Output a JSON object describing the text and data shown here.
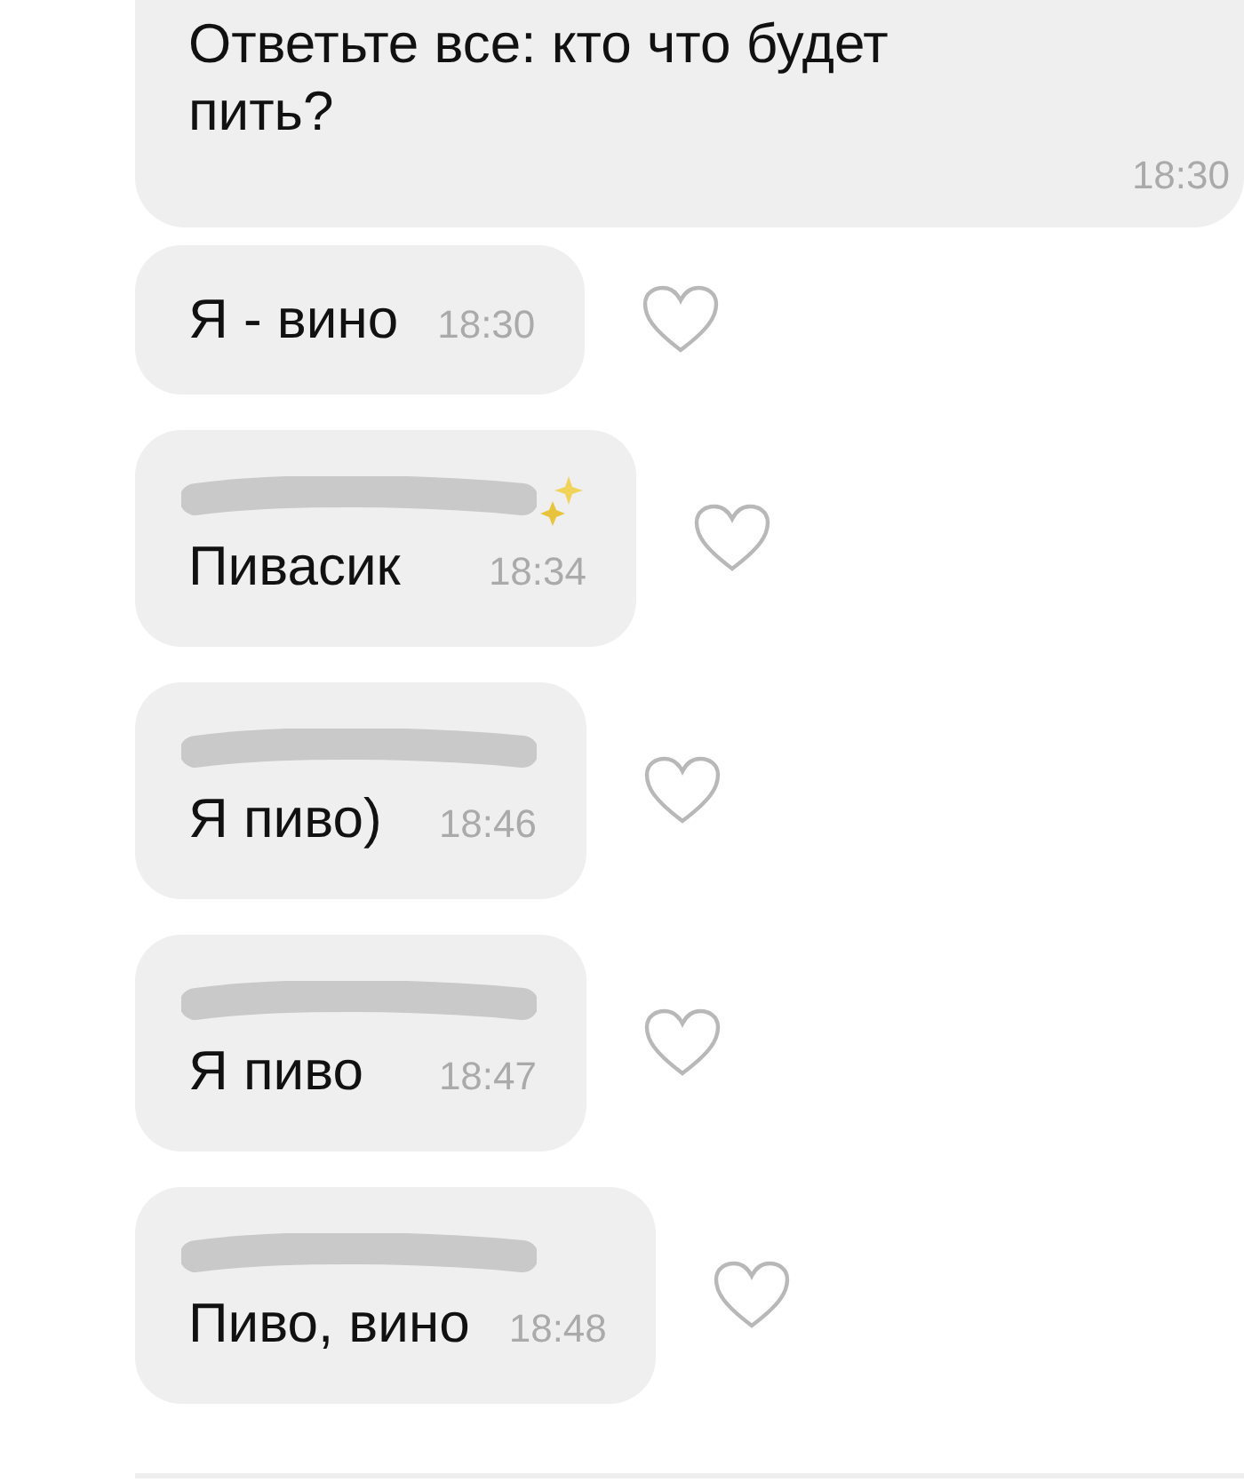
{
  "messages": [
    {
      "kind": "plain",
      "text": "Ответьте все: кто что будет пить?",
      "time": "18:30",
      "heart": false
    },
    {
      "kind": "plain",
      "text": "Я - вино",
      "time": "18:30",
      "heart": true
    },
    {
      "kind": "with_sender",
      "sender_badge": true,
      "text": "Пивасик",
      "time": "18:34",
      "heart": true
    },
    {
      "kind": "with_sender",
      "sender_badge": false,
      "text": "Я пиво)",
      "time": "18:46",
      "heart": true
    },
    {
      "kind": "with_sender",
      "sender_badge": false,
      "text": "Я пиво",
      "time": "18:47",
      "heart": true
    },
    {
      "kind": "with_sender",
      "sender_badge": false,
      "text": "Пиво, вино",
      "time": "18:48",
      "heart": true
    }
  ]
}
